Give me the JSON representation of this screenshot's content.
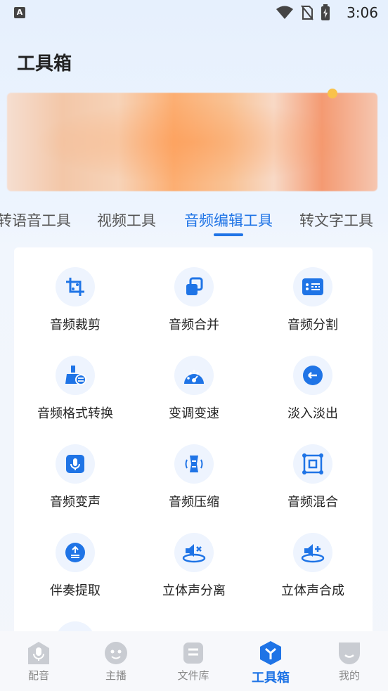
{
  "status_bar": {
    "time": "3:06",
    "app_badge": "A"
  },
  "page_title": "工具箱",
  "tabs": [
    {
      "label": "转语音工具"
    },
    {
      "label": "视频工具"
    },
    {
      "label": "音频编辑工具",
      "active": true
    },
    {
      "label": "转文字工具"
    }
  ],
  "tools": [
    {
      "label": "音频裁剪",
      "icon": "crop-icon"
    },
    {
      "label": "音频合并",
      "icon": "merge-icon"
    },
    {
      "label": "音频分割",
      "icon": "split-icon"
    },
    {
      "label": "音频格式转换",
      "icon": "format-convert-icon"
    },
    {
      "label": "变调变速",
      "icon": "speed-dial-icon"
    },
    {
      "label": "淡入淡出",
      "icon": "fade-icon"
    },
    {
      "label": "音频变声",
      "icon": "voice-change-icon"
    },
    {
      "label": "音频压缩",
      "icon": "compress-icon"
    },
    {
      "label": "音频混合",
      "icon": "mix-icon"
    },
    {
      "label": "伴奏提取",
      "icon": "extract-icon"
    },
    {
      "label": "立体声分离",
      "icon": "stereo-split-icon"
    },
    {
      "label": "立体声合成",
      "icon": "stereo-merge-icon"
    }
  ],
  "bottom_nav": [
    {
      "label": "配音",
      "icon": "mic-icon"
    },
    {
      "label": "主播",
      "icon": "face-icon"
    },
    {
      "label": "文件库",
      "icon": "folder-icon"
    },
    {
      "label": "工具箱",
      "icon": "toolbox-icon",
      "active": true
    },
    {
      "label": "我的",
      "icon": "profile-icon"
    }
  ],
  "colors": {
    "accent": "#1f74e6",
    "icon_bg": "#eef4fe",
    "nav_inactive": "#c9ccd2"
  }
}
